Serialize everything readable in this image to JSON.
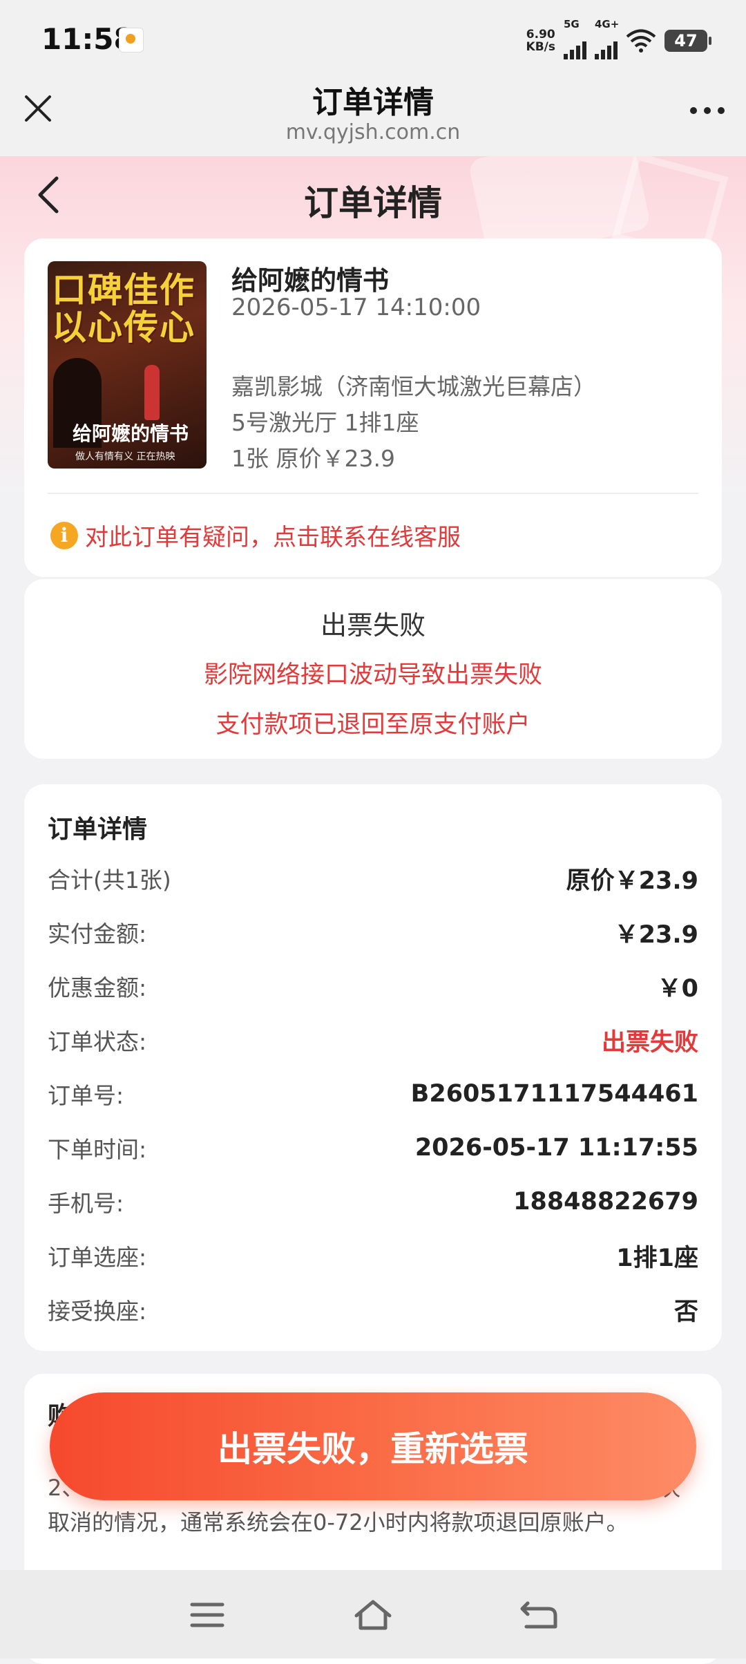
{
  "status_bar": {
    "time": "11:58",
    "net_speed_value": "6.90",
    "net_speed_unit": "KB/s",
    "sim1": "5G",
    "sim2": "4G+",
    "battery": "47"
  },
  "browser_bar": {
    "title": "订单详情",
    "url": "mv.qyjsh.com.cn"
  },
  "page": {
    "title": "订单详情"
  },
  "movie": {
    "poster_line1": "口碑佳作",
    "poster_line2": "以心传心",
    "poster_title": "给阿嬷的情书",
    "poster_tagline": "做人有情有义 正在热映",
    "name": "给阿嬷的情书",
    "showtime": "2026-05-17 14:10:00",
    "cinema": "嘉凯影城（济南恒大城激光巨幕店）",
    "hall_seat": "5号激光厅 1排1座",
    "ticket_price": "1张  原价￥23.9",
    "help_text": "对此订单有疑问，点击联系在线客服"
  },
  "status_card": {
    "title": "出票失败",
    "line1": "影院网络接口波动导致出票失败",
    "line2": "支付款项已退回至原支付账户"
  },
  "order_details": {
    "title": "订单详情",
    "rows": [
      {
        "key": "合计(共1张)",
        "value": "原价￥23.9"
      },
      {
        "key": "实付金额:",
        "value": "￥23.9"
      },
      {
        "key": "优惠金额:",
        "value": "￥0"
      },
      {
        "key": "订单状态:",
        "value": "出票失败"
      },
      {
        "key": "订单号:",
        "value": "B2605171117544461"
      },
      {
        "key": "下单时间:",
        "value": "2026-05-17 11:17:55"
      },
      {
        "key": "手机号:",
        "value": "18848822679"
      },
      {
        "key": "订单选座:",
        "value": "1排1座"
      },
      {
        "key": "接受换座:",
        "value": "否"
      }
    ]
  },
  "notice": {
    "title": "购",
    "text": "2、由于设备故障、影院系统不稳定等不可抗因素，存在少量场次取消的情况，通常系统会在0-72小时内将款项退回原账户。"
  },
  "cta_button": {
    "label": "出票失败，重新选票"
  },
  "colors": {
    "accent_red": "#e23a3a",
    "cta_start": "#f6492d",
    "cta_end": "#fd8c66",
    "info_orange": "#f5a623"
  },
  "icons": {
    "close": "close-icon",
    "more": "more-icon",
    "back": "back-arrow-icon",
    "info": "info-icon",
    "menu": "menu-icon",
    "home": "home-icon",
    "back_nav": "back-nav-icon"
  }
}
